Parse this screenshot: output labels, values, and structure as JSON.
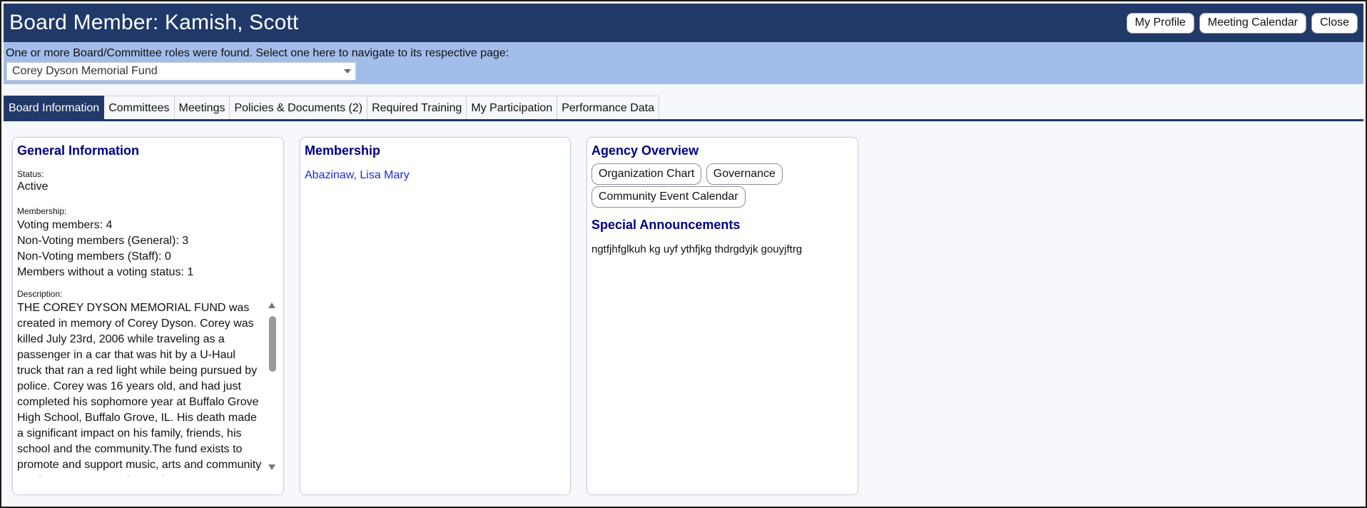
{
  "header": {
    "title": "Board Member: Kamish, Scott",
    "buttons": {
      "profile": "My Profile",
      "calendar": "Meeting Calendar",
      "close": "Close"
    }
  },
  "roles": {
    "message": "One or more Board/Committee roles were found.  Select one here to navigate to its respective page:",
    "selected": "Corey Dyson Memorial Fund"
  },
  "tabs": [
    {
      "label": "Board Information",
      "active": true
    },
    {
      "label": "Committees"
    },
    {
      "label": "Meetings"
    },
    {
      "label": "Policies & Documents (2)"
    },
    {
      "label": "Required Training"
    },
    {
      "label": "My Participation"
    },
    {
      "label": "Performance Data"
    }
  ],
  "general": {
    "heading": "General Information",
    "status_label": "Status:",
    "status_value": "Active",
    "membership_label": "Membership:",
    "voting": "Voting members: 4",
    "nonvoting_general": "Non-Voting members (General): 3",
    "nonvoting_staff": "Non-Voting members (Staff): 0",
    "no_status": "Members without a voting status: 1",
    "description_label": "Description:",
    "description": "THE COREY DYSON MEMORIAL FUND was created in memory of Corey Dyson. Corey was killed July 23rd, 2006 while traveling as a passenger in a car that was hit by a U-Haul truck that ran a red light while being pursued by police. Corey was 16 years old, and had just completed his sophomore year at Buffalo Grove High School, Buffalo Grove, IL. His death made a significant impact on his family, friends, his school and the community.The fund exists to promote and support music, arts and community service programs as deemed"
  },
  "membership": {
    "heading": "Membership",
    "members": [
      "Abazinaw, Lisa Mary"
    ]
  },
  "agency": {
    "heading": "Agency Overview",
    "buttons": [
      "Organization Chart",
      "Governance",
      "Community Event Calendar"
    ],
    "announcements_heading": "Special Announcements",
    "announcement": "ngtfjhfglkuh kg uyf ythfjkg thdrgdyjk gouyjftrg"
  }
}
